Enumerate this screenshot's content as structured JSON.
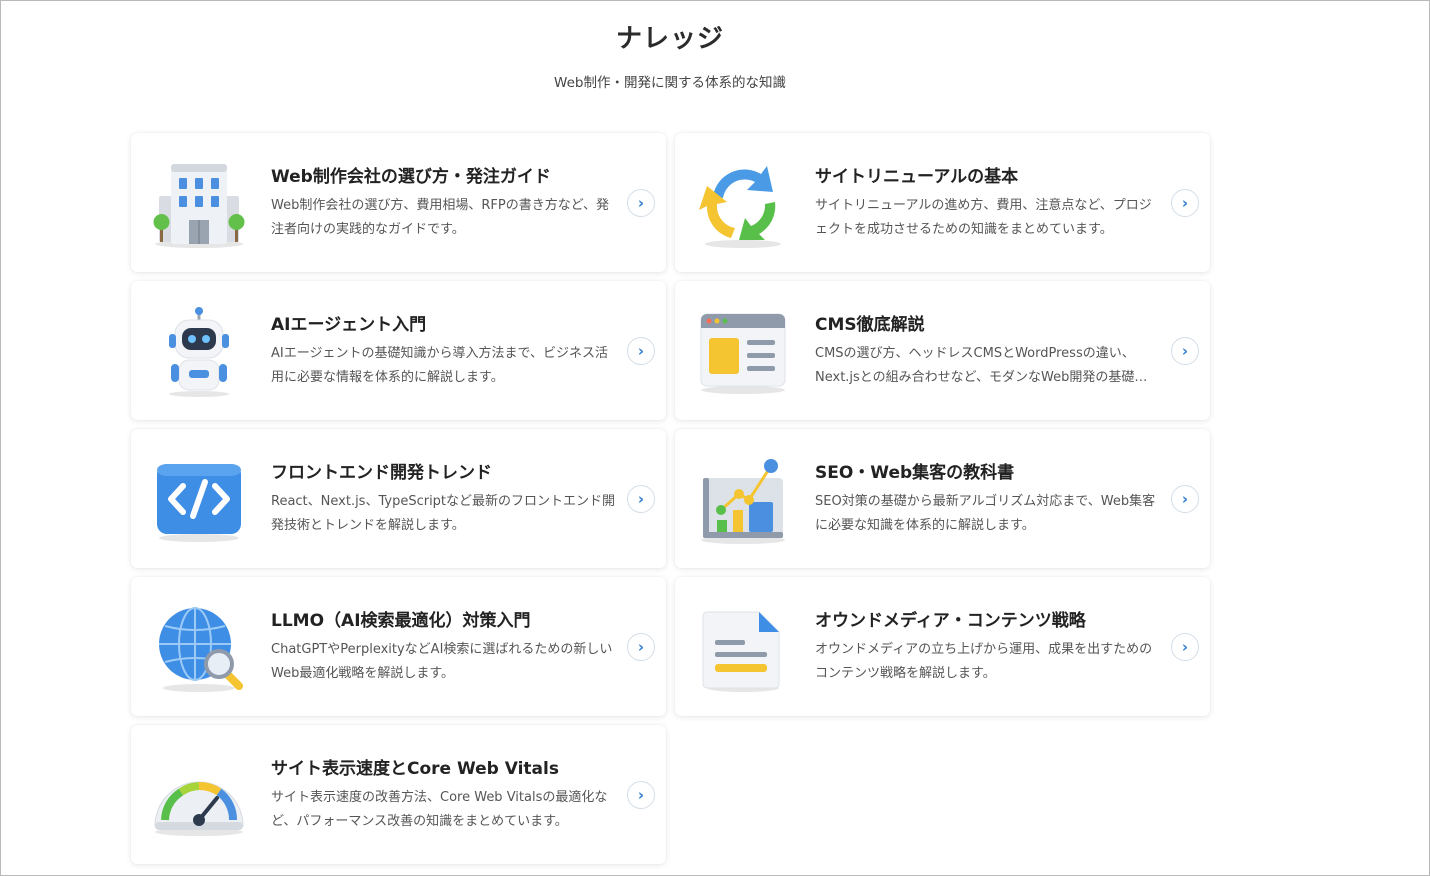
{
  "header": {
    "title": "ナレッジ",
    "subtitle": "Web制作・開発に関する体系的な知識"
  },
  "cards": [
    {
      "title": "Web制作会社の選び方・発注ガイド",
      "desc": "Web制作会社の選び方、費用相場、RFPの書き方など、発注者向けの実践的なガイドです。",
      "icon": "office-building-icon"
    },
    {
      "title": "サイトリニューアルの基本",
      "desc": "サイトリニューアルの進め方、費用、注意点など、プロジェクトを成功させるための知識をまとめています。",
      "icon": "renew-arrows-icon"
    },
    {
      "title": "AIエージェント入門",
      "desc": "AIエージェントの基礎知識から導入方法まで、ビジネス活用に必要な情報を体系的に解説します。",
      "icon": "robot-icon"
    },
    {
      "title": "CMS徹底解説",
      "desc": "CMSの選び方、ヘッドレスCMSとWordPressの違い、Next.jsとの組み合わせなど、モダンなWeb開発の基礎を解説します。",
      "icon": "browser-window-icon"
    },
    {
      "title": "フロントエンド開発トレンド",
      "desc": "React、Next.js、TypeScriptなど最新のフロントエンド開発技術とトレンドを解説します。",
      "icon": "code-icon"
    },
    {
      "title": "SEO・Web集客の教科書",
      "desc": "SEO対策の基礎から最新アルゴリズム対応まで、Web集客に必要な知識を体系的に解説します。",
      "icon": "growth-chart-icon"
    },
    {
      "title": "LLMO（AI検索最適化）対策入門",
      "desc": "ChatGPTやPerplexityなどAI検索に選ばれるための新しいWeb最適化戦略を解説します。",
      "icon": "globe-search-icon"
    },
    {
      "title": "オウンドメディア・コンテンツ戦略",
      "desc": "オウンドメディアの立ち上げから運用、成果を出すためのコンテンツ戦略を解説します。",
      "icon": "document-icon"
    },
    {
      "title": "サイト表示速度とCore Web Vitals",
      "desc": "サイト表示速度の改善方法、Core Web Vitalsの最適化など、パフォーマンス改善の知識をまとめています。",
      "icon": "speedometer-icon"
    }
  ]
}
